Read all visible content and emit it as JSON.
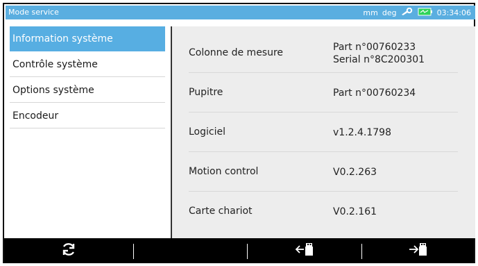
{
  "status_bar": {
    "title": "Mode service",
    "unit_length": "mm",
    "unit_angle": "deg",
    "time": "03:34:06",
    "battery_icon": "battery-icon",
    "wrench_icon": "wrench-icon"
  },
  "sidebar": {
    "items": [
      {
        "label": "Information système",
        "active": true
      },
      {
        "label": "Contrôle système",
        "active": false
      },
      {
        "label": "Options système",
        "active": false
      },
      {
        "label": "Encodeur",
        "active": false
      }
    ]
  },
  "info": {
    "rows": [
      {
        "label": "Colonne de mesure",
        "value_line1": "Part n°00760233",
        "value_line2": "Serial n°8C200301"
      },
      {
        "label": "Pupitre",
        "value_line1": "Part n°00760234",
        "value_line2": ""
      },
      {
        "label": "Logiciel",
        "value_line1": "v1.2.4.1798",
        "value_line2": ""
      },
      {
        "label": "Motion control",
        "value_line1": "V0.2.263",
        "value_line2": ""
      },
      {
        "label": "Carte chariot",
        "value_line1": "V0.2.161",
        "value_line2": ""
      }
    ]
  },
  "toolbar": {
    "refresh_icon": "refresh-icon",
    "import_icon": "usb-import-icon",
    "export_icon": "usb-export-icon"
  },
  "colors": {
    "accent": "#57aee2",
    "status_bg": "#5aaee0",
    "panel_bg": "#ededed",
    "toolbar_bg": "#000000"
  }
}
